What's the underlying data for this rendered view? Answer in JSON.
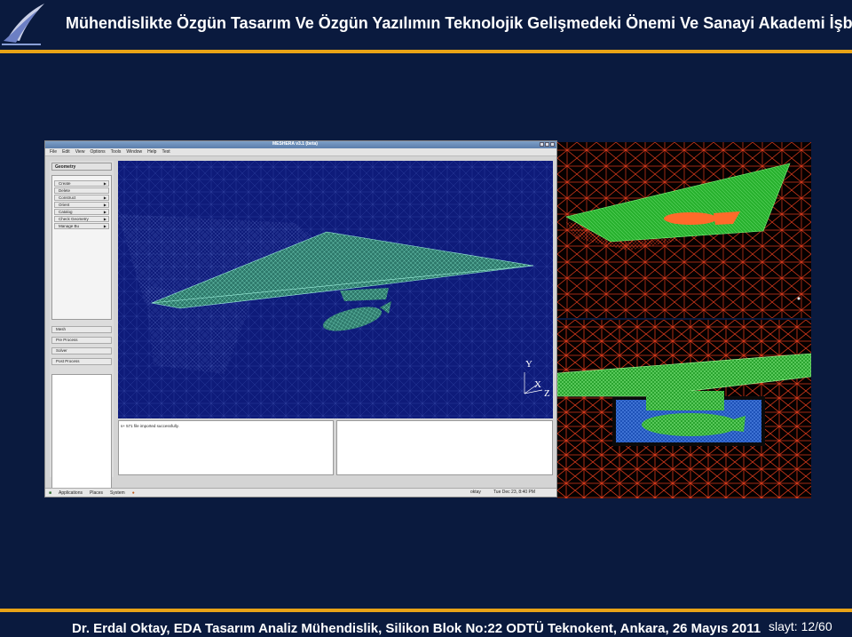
{
  "header": {
    "title": "Mühendislikte Özgün Tasarım Ve Özgün Yazılımın Teknolojik Gelişmedeki Önemi Ve Sanayi Akademi İşbirliği",
    "logo_icon": "eda-swoosh-logo"
  },
  "colors": {
    "background": "#0a1a3e",
    "accent_rule": "#e8a317",
    "viewport_bg": "#0e1b7a",
    "mesh_green": "#3dd43d",
    "mesh_red": "#e0401a",
    "mesh_blue": "#2a64d8"
  },
  "app": {
    "window_title": "MESHERA v3.1 (beta)",
    "menu": [
      "File",
      "Edit",
      "View",
      "Options",
      "Tools",
      "Window",
      "Help",
      "Test"
    ],
    "panel_header": "Geometry",
    "geometry_items": [
      {
        "label": "Create"
      },
      {
        "label": "Delete"
      },
      {
        "label": "Construct"
      },
      {
        "label": "Orient"
      },
      {
        "label": "Catalog"
      },
      {
        "label": "Check Geometry"
      },
      {
        "label": "Manage Bu"
      }
    ],
    "workflow_buttons": [
      "Mesh",
      "Pre Process",
      "Solver",
      "Post Process"
    ],
    "axes": {
      "y": "Y",
      "x": "X",
      "z": "Z"
    },
    "console_text": "s+ 571 file imported successfully.",
    "taskbar": {
      "items": [
        "Applications",
        "Places",
        "System"
      ],
      "user": "oktay",
      "datetime": "Tue Dec 23,  8:40 PM"
    }
  },
  "footer": {
    "text": "Dr. Erdal Oktay, EDA Tasarım Analiz Mühendislik, Silikon Blok No:22  ODTÜ Teknokent, Ankara, 26 Mayıs 2011",
    "slide_number": "slayt: 12/60"
  }
}
